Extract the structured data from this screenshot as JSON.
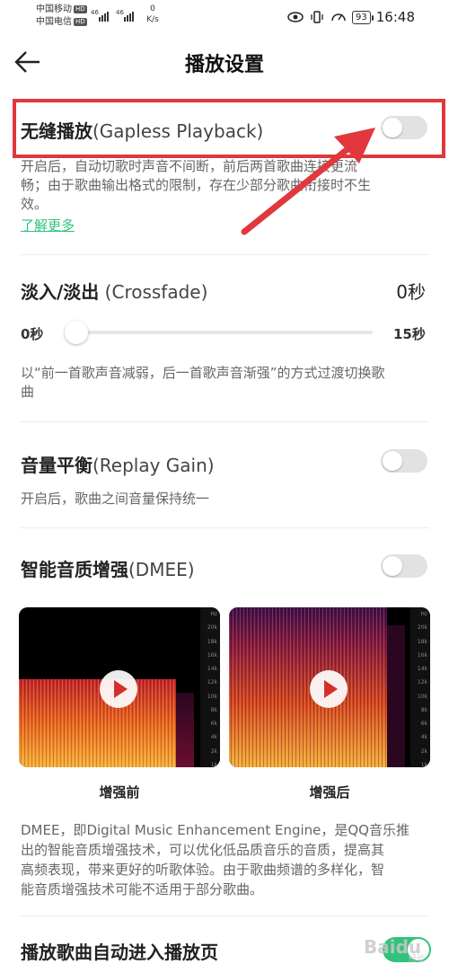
{
  "status_bar": {
    "carrier1": "中国移动",
    "carrier2": "中国电信",
    "hd": "HD",
    "net1": "46",
    "net2": "46",
    "speed_value": "0",
    "speed_unit": "K/s",
    "battery": "93",
    "time": "16:48"
  },
  "header": {
    "title": "播放设置"
  },
  "gapless": {
    "title_cn": "无缝播放",
    "title_en": "(Gapless Playback)",
    "desc_line1": "开启后，自动切歌时声音不间断，前后两首歌曲连接更流",
    "desc_line2": "畅；由于歌曲输出格式的限制，存在少部分歌曲衔接时不生",
    "desc_line3": "效。",
    "link": "了解更多",
    "enabled": false
  },
  "crossfade": {
    "title_cn": "淡入/淡出",
    "title_en": "(Crossfade)",
    "value_label": "0秒",
    "min_label": "0秒",
    "max_label": "15秒",
    "value": 0,
    "desc_line1": "以“前一首歌声音减弱，后一首歌声音渐强”的方式过渡切换歌",
    "desc_line2": "曲"
  },
  "replay_gain": {
    "title_cn": "音量平衡",
    "title_en": "(Replay Gain)",
    "desc": "开启后，歌曲之间音量保持统一",
    "enabled": false
  },
  "dmee": {
    "title_cn": "智能音质增强",
    "title_en": "(DMEE)",
    "enabled": false,
    "before_caption": "增强前",
    "after_caption": "增强后",
    "axis_labels": [
      "Hz",
      "20k",
      "18k",
      "16k",
      "14k",
      "12k",
      "10k",
      "8k",
      "6k",
      "4k",
      "2k",
      "1k"
    ],
    "desc_line1": "DMEE，即Digital Music Enhancement Engine，是QQ音乐推",
    "desc_line2": "出的智能音质增强技术，可以优化低品质音乐的音质，提高其",
    "desc_line3": "高频表现，带来更好的听歌体验。由于歌曲频谱的多样化，智",
    "desc_line4": "能音质增强技术可能不适用于部分歌曲。"
  },
  "auto_play_page": {
    "title": "播放歌曲自动进入播放页",
    "enabled": true
  },
  "watermark": {
    "text": "Baidu",
    "sub": "经验"
  },
  "colors": {
    "accent": "#31c27c",
    "annotation": "#e0383d",
    "toggle_off": "#e2e2e2"
  }
}
